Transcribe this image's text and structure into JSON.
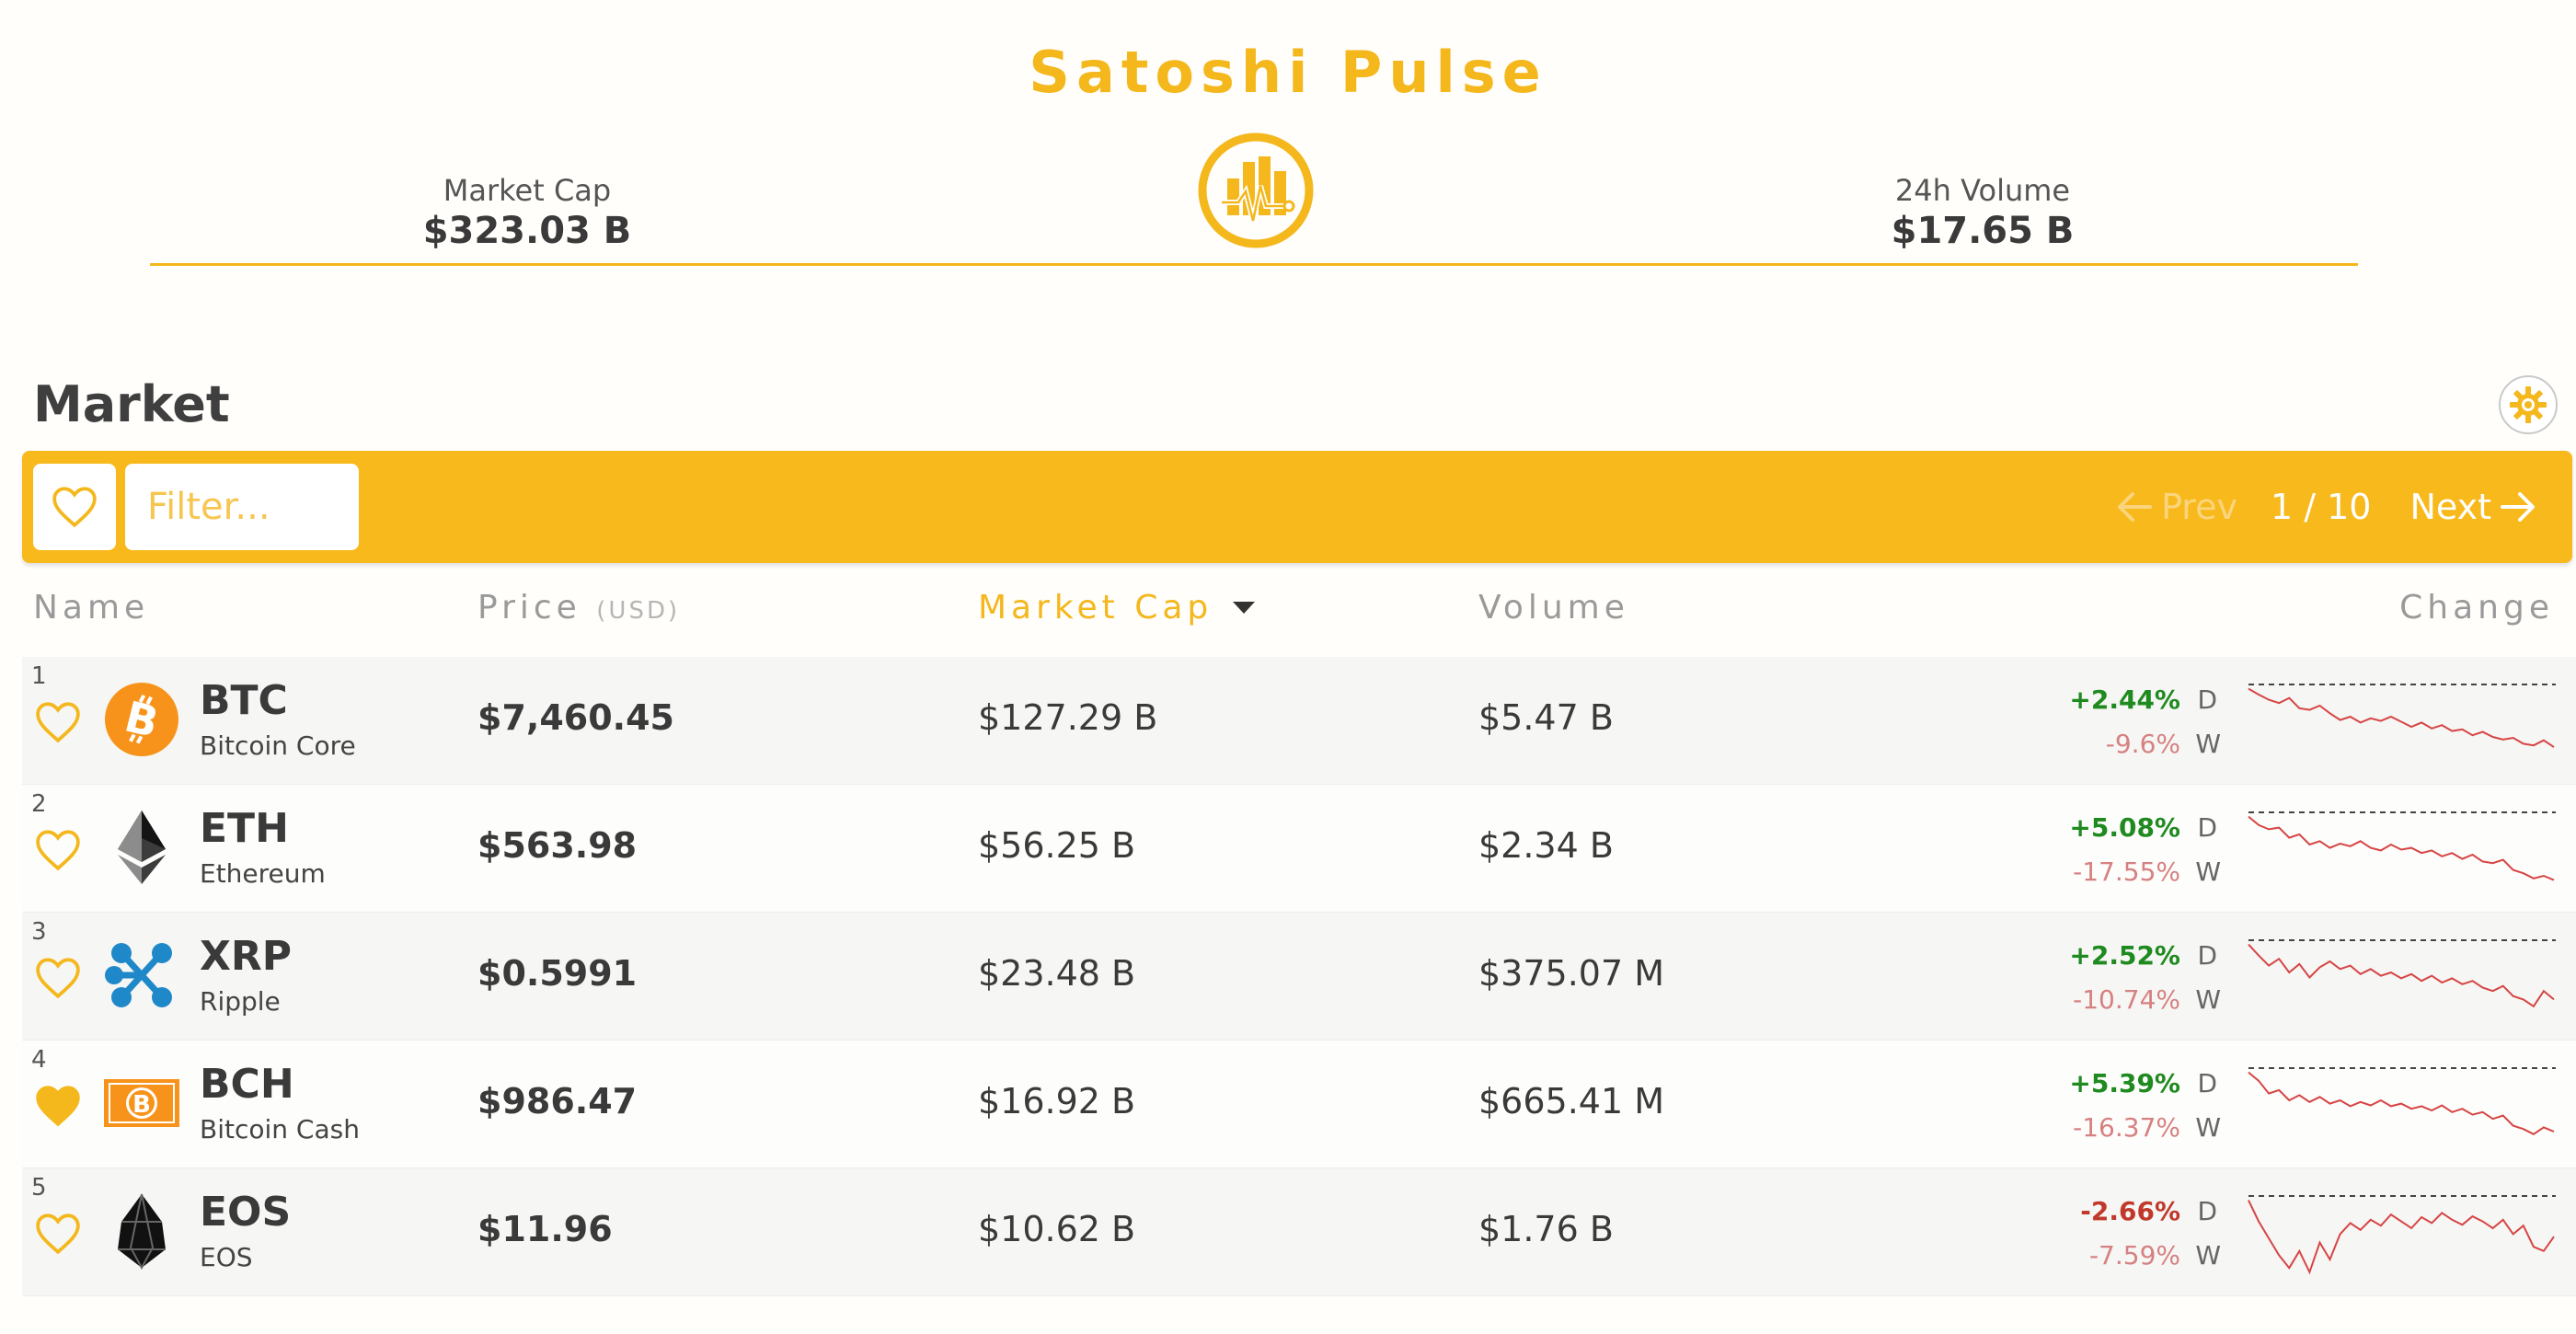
{
  "app": {
    "title": "Satoshi Pulse"
  },
  "stats": {
    "market_cap_label": "Market Cap",
    "market_cap_value": "$323.03 B",
    "volume_label": "24h Volume",
    "volume_value": "$17.65 B"
  },
  "market": {
    "title": "Market",
    "filter_placeholder": "Filter...",
    "prev_label": "Prev",
    "page_indicator": "1 / 10",
    "next_label": "Next"
  },
  "columns": {
    "name": "Name",
    "price": "Price",
    "price_unit": "(USD)",
    "market_cap": "Market Cap",
    "volume": "Volume",
    "change": "Change"
  },
  "colors": {
    "accent": "#f4b71c",
    "positive": "#1f8a1f",
    "negative": "#c0392b",
    "spark": "#d64545"
  },
  "coins": [
    {
      "rank": "1",
      "symbol": "BTC",
      "name": "Bitcoin Core",
      "price": "$7,460.45",
      "market_cap": "$127.29 B",
      "volume": "$5.47 B",
      "change_d": "+2.44%",
      "change_w": "-9.6%",
      "favorite": false,
      "icon": "bitcoin-icon",
      "spark": [
        0.95,
        0.88,
        0.82,
        0.78,
        0.84,
        0.72,
        0.7,
        0.75,
        0.66,
        0.58,
        0.62,
        0.55,
        0.6,
        0.57,
        0.62,
        0.56,
        0.5,
        0.55,
        0.48,
        0.52,
        0.45,
        0.47,
        0.4,
        0.44,
        0.38,
        0.35,
        0.37,
        0.3,
        0.28,
        0.34,
        0.26
      ]
    },
    {
      "rank": "2",
      "symbol": "ETH",
      "name": "Ethereum",
      "price": "$563.98",
      "market_cap": "$56.25 B",
      "volume": "$2.34 B",
      "change_d": "+5.08%",
      "change_w": "-17.55%",
      "favorite": false,
      "icon": "ethereum-icon",
      "spark": [
        0.95,
        0.85,
        0.8,
        0.82,
        0.7,
        0.74,
        0.62,
        0.66,
        0.58,
        0.63,
        0.6,
        0.66,
        0.58,
        0.55,
        0.62,
        0.56,
        0.58,
        0.52,
        0.55,
        0.48,
        0.52,
        0.45,
        0.5,
        0.42,
        0.4,
        0.44,
        0.32,
        0.28,
        0.22,
        0.25,
        0.2
      ]
    },
    {
      "rank": "3",
      "symbol": "XRP",
      "name": "Ripple",
      "price": "$0.5991",
      "market_cap": "$23.48 B",
      "volume": "$375.07 M",
      "change_d": "+2.52%",
      "change_w": "-10.74%",
      "favorite": false,
      "icon": "ripple-icon",
      "spark": [
        0.95,
        0.82,
        0.7,
        0.78,
        0.62,
        0.72,
        0.56,
        0.68,
        0.75,
        0.66,
        0.7,
        0.6,
        0.66,
        0.58,
        0.62,
        0.55,
        0.6,
        0.52,
        0.58,
        0.5,
        0.55,
        0.48,
        0.52,
        0.44,
        0.4,
        0.46,
        0.34,
        0.3,
        0.22,
        0.4,
        0.3
      ]
    },
    {
      "rank": "4",
      "symbol": "BCH",
      "name": "Bitcoin Cash",
      "price": "$986.47",
      "market_cap": "$16.92 B",
      "volume": "$665.41 M",
      "change_d": "+5.39%",
      "change_w": "-16.37%",
      "favorite": true,
      "icon": "bitcoin-cash-icon",
      "spark": [
        0.95,
        0.85,
        0.7,
        0.74,
        0.62,
        0.68,
        0.6,
        0.66,
        0.58,
        0.62,
        0.55,
        0.6,
        0.56,
        0.62,
        0.55,
        0.58,
        0.52,
        0.55,
        0.5,
        0.56,
        0.48,
        0.52,
        0.45,
        0.48,
        0.4,
        0.44,
        0.32,
        0.28,
        0.22,
        0.3,
        0.25
      ]
    },
    {
      "rank": "5",
      "symbol": "EOS",
      "name": "EOS",
      "price": "$11.96",
      "market_cap": "$10.62 B",
      "volume": "$1.76 B",
      "change_d": "-2.66%",
      "change_w": "-7.59%",
      "favorite": false,
      "icon": "eos-icon",
      "spark": [
        0.95,
        0.7,
        0.5,
        0.3,
        0.15,
        0.35,
        0.1,
        0.45,
        0.25,
        0.55,
        0.68,
        0.6,
        0.72,
        0.65,
        0.78,
        0.7,
        0.62,
        0.75,
        0.68,
        0.8,
        0.72,
        0.66,
        0.76,
        0.7,
        0.62,
        0.72,
        0.55,
        0.65,
        0.4,
        0.35,
        0.52
      ]
    }
  ]
}
